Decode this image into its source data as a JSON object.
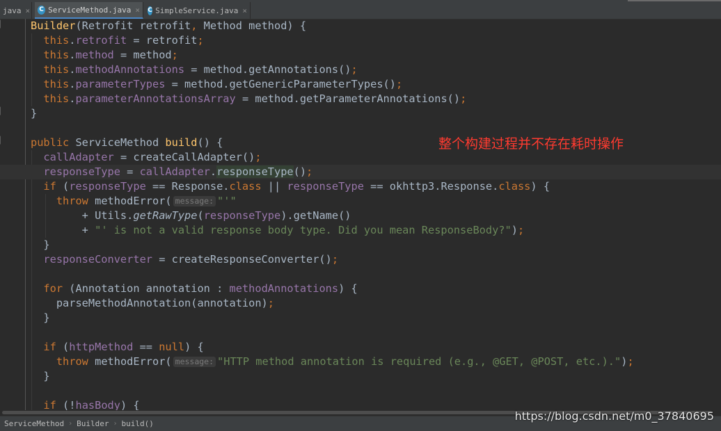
{
  "tabs": [
    {
      "label": "java",
      "active": false
    },
    {
      "label": "ServiceMethod.java",
      "active": true
    },
    {
      "label": "SimpleService.java",
      "active": false
    }
  ],
  "tab_icon_letter": "C",
  "close_glyph": "×",
  "annotation": "整个构建过程并不存在耗时操作",
  "hints": {
    "message": "message:"
  },
  "breadcrumb": [
    "ServiceMethod",
    "Builder",
    "build()"
  ],
  "watermark": "https://blog.csdn.net/m0_37840695",
  "colors": {
    "background": "#2b2b2b",
    "keyword": "#cc7832",
    "field": "#9876aa",
    "method_decl": "#ffc66d",
    "string": "#6a8759",
    "annotation_text": "#ff3b30"
  }
}
